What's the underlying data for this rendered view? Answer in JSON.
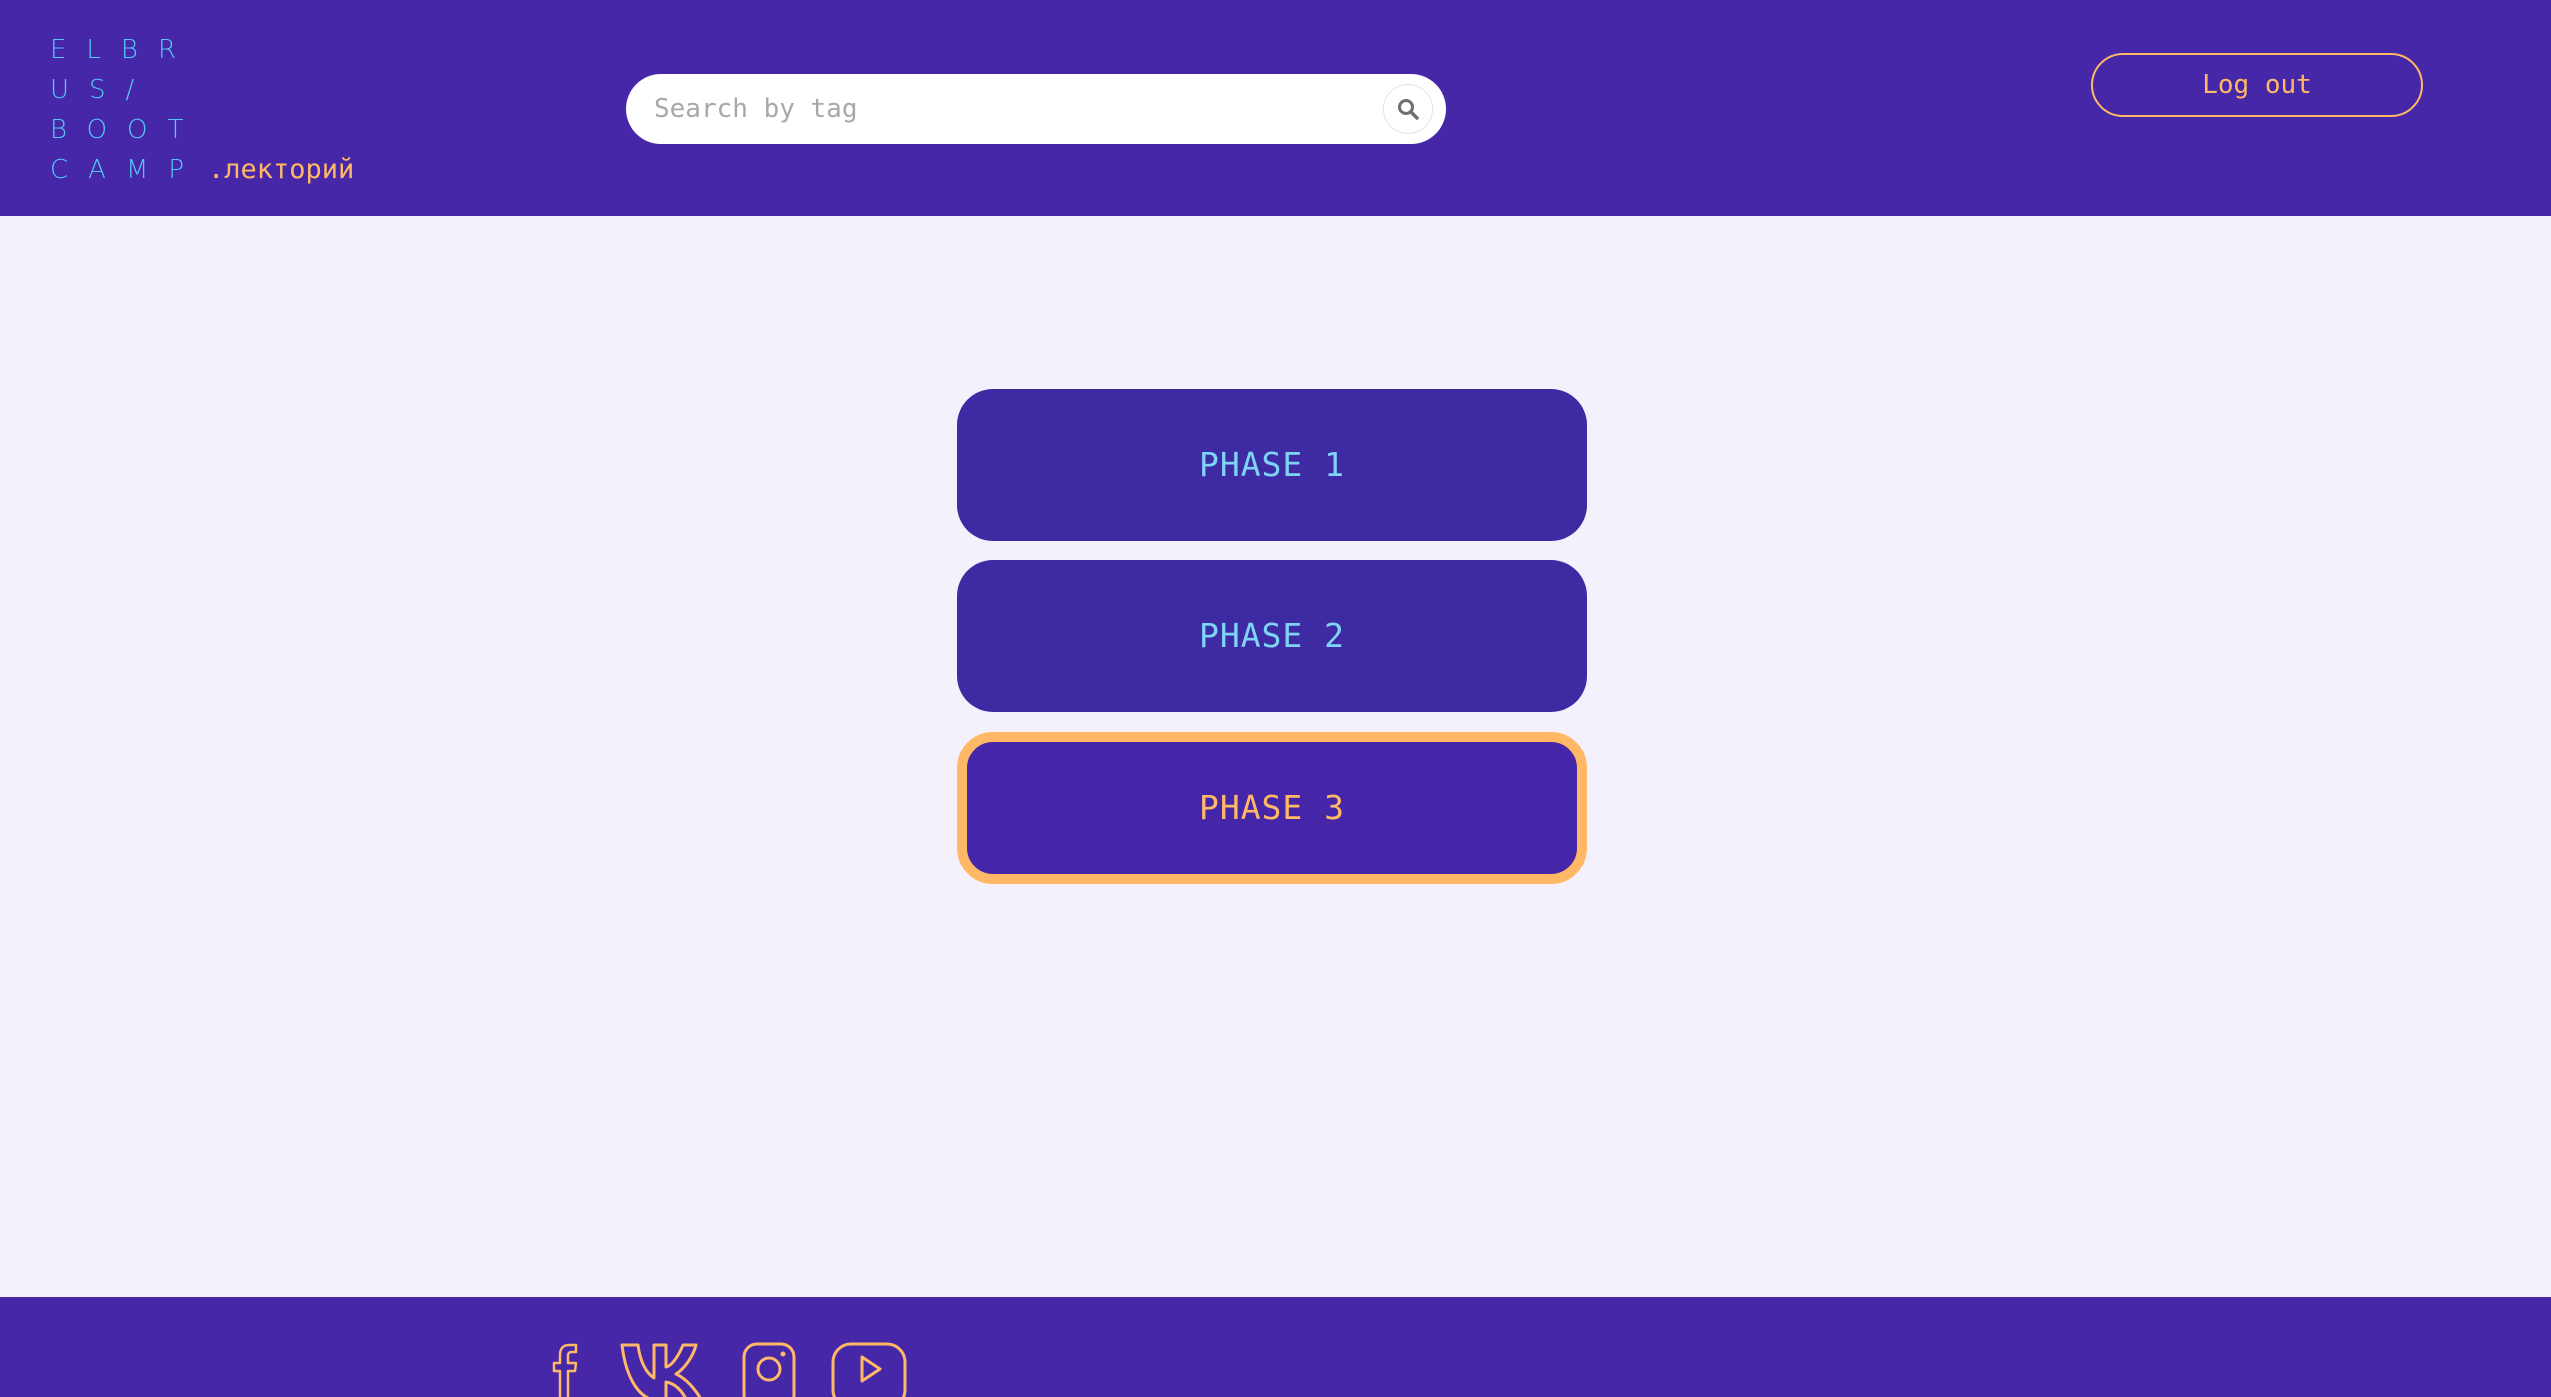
{
  "logo": {
    "lines": [
      "ELBR",
      "US/",
      "BOOT",
      "CAMP"
    ],
    "suffix": ".лекторий"
  },
  "search": {
    "placeholder": "Search by tag",
    "value": "",
    "icon": "search-icon"
  },
  "header": {
    "logout_label": "Log out"
  },
  "phases": [
    {
      "label": "PHASE 1",
      "active": false
    },
    {
      "label": "PHASE 2",
      "active": false
    },
    {
      "label": "PHASE 3",
      "active": true
    }
  ],
  "footer": {
    "social_icons": [
      "facebook-icon",
      "vk-icon",
      "instagram-icon",
      "youtube-icon"
    ]
  },
  "colors": {
    "header_bg": "#4527a8",
    "page_bg": "#f4f0fc",
    "logo_text": "#55c8f3",
    "accent_orange": "#ffb866",
    "phase_bg": "#3e2aa3",
    "phase_text": "#7fd4f6"
  }
}
